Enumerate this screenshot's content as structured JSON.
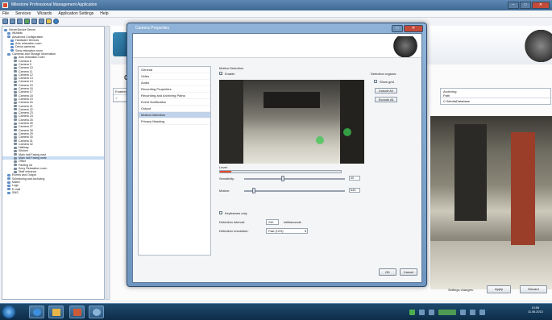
{
  "app": {
    "title": "Milestone Professional Management Application",
    "menu": [
      "File",
      "Services",
      "Wizards",
      "Application Settings",
      "Help"
    ]
  },
  "tree": {
    "items": [
      {
        "label": "ServerDevice Server",
        "type": "root",
        "sel": false
      },
      {
        "label": "Wizards",
        "type": "folder",
        "sel": false
      },
      {
        "label": "Advanced Configuration",
        "type": "folder",
        "sel": false
      },
      {
        "label": "Hardware Devices",
        "type": "folder",
        "sel": false
      },
      {
        "label": "Axis relaxation room",
        "type": "folder",
        "sel": false
      },
      {
        "label": "Demo cameras",
        "type": "folder",
        "sel": false
      },
      {
        "label": "Sony relaxation room",
        "type": "folder",
        "sel": false
      },
      {
        "label": "Cameras and Storage Information",
        "type": "folder",
        "sel": false
      },
      {
        "label": "Axis relaxation room",
        "type": "cam",
        "sel": false
      },
      {
        "label": "Camera 8",
        "type": "cam",
        "sel": false
      },
      {
        "label": "Camera 9",
        "type": "cam",
        "sel": false
      },
      {
        "label": "Camera 10",
        "type": "cam",
        "sel": false
      },
      {
        "label": "Camera 11",
        "type": "cam",
        "sel": false
      },
      {
        "label": "Camera 12",
        "type": "cam",
        "sel": false
      },
      {
        "label": "Camera 13",
        "type": "cam",
        "sel": false
      },
      {
        "label": "Camera 14",
        "type": "cam",
        "sel": false
      },
      {
        "label": "Camera 15",
        "type": "cam",
        "sel": false
      },
      {
        "label": "Camera 16",
        "type": "cam",
        "sel": false
      },
      {
        "label": "Camera 17",
        "type": "cam",
        "sel": false
      },
      {
        "label": "Camera 18",
        "type": "cam",
        "sel": false
      },
      {
        "label": "Camera 19",
        "type": "cam",
        "sel": false
      },
      {
        "label": "Camera 20",
        "type": "cam",
        "sel": false
      },
      {
        "label": "Camera 21",
        "type": "cam",
        "sel": false
      },
      {
        "label": "Camera 22",
        "type": "cam",
        "sel": false
      },
      {
        "label": "Camera 23",
        "type": "cam",
        "sel": false
      },
      {
        "label": "Camera 24",
        "type": "cam",
        "sel": false
      },
      {
        "label": "Camera 25",
        "type": "cam",
        "sel": false
      },
      {
        "label": "Camera 26",
        "type": "cam",
        "sel": false
      },
      {
        "label": "Camera 27",
        "type": "cam",
        "sel": false
      },
      {
        "label": "Camera 28",
        "type": "cam",
        "sel": false
      },
      {
        "label": "Camera 29",
        "type": "cam",
        "sel": false
      },
      {
        "label": "Camera 30",
        "type": "cam",
        "sel": false
      },
      {
        "label": "Camera 31",
        "type": "cam",
        "sel": false
      },
      {
        "label": "Camera 32",
        "type": "cam",
        "sel": false
      },
      {
        "label": "Hallway",
        "type": "cam",
        "sel": false
      },
      {
        "label": "Kitchen",
        "type": "cam",
        "sel": false
      },
      {
        "label": "Main hall Facing east",
        "type": "cam",
        "sel": false
      },
      {
        "label": "Main hall Facing west",
        "type": "cam",
        "sel": true
      },
      {
        "label": "Office",
        "type": "cam",
        "sel": false
      },
      {
        "label": "Parking lot",
        "type": "cam",
        "sel": false
      },
      {
        "label": "Sony Relaxation room",
        "type": "cam",
        "sel": false
      },
      {
        "label": "Staff entrance",
        "type": "cam",
        "sel": false
      },
      {
        "label": "Events and Output",
        "type": "folder",
        "sel": false
      },
      {
        "label": "Scheduling and Archiving",
        "type": "folder",
        "sel": false
      },
      {
        "label": "Matrix",
        "type": "folder",
        "sel": false
      },
      {
        "label": "Logs",
        "type": "folder",
        "sel": false
      },
      {
        "label": "E-mail",
        "type": "folder",
        "sel": false
      },
      {
        "label": "SMS",
        "type": "folder",
        "sel": false
      }
    ]
  },
  "main": {
    "section_title": "Ca",
    "table_header": "Enabled",
    "table_row_check": "✓",
    "right_table": {
      "header1": "Archiving",
      "header2": "Path",
      "row_value": "C:\\MediaDatabase"
    },
    "settings_changes_label": "Settings changes:",
    "apply_label": "Apply",
    "discard_label": "Discard"
  },
  "dialog": {
    "title": "Camera Properties",
    "nav": [
      {
        "label": "General",
        "sel": false
      },
      {
        "label": "Video",
        "sel": false
      },
      {
        "label": "Audio",
        "sel": false
      },
      {
        "label": "Recording Properties",
        "sel": false
      },
      {
        "label": "Recording and Archiving Paths",
        "sel": false
      },
      {
        "label": "Event Notification",
        "sel": false
      },
      {
        "label": "Output",
        "sel": false
      },
      {
        "label": "Motion Detection",
        "sel": true
      },
      {
        "label": "Privacy Masking",
        "sel": false
      }
    ],
    "motion": {
      "heading": "Motion Detection",
      "enable_label": "Enable",
      "enable_checked": true,
      "regions_label": "Detection regions:",
      "show_grid_label": "Show grid",
      "include_all_label": "Include All",
      "exclude_all_label": "Exclude All",
      "level_label": "Level:",
      "level_value": 0.09,
      "sensitivity_label": "Sensitivity:",
      "sensitivity_value": "40",
      "sensitivity_pos": 0.38,
      "motion_label": "Motion:",
      "motion_value": "640",
      "motion_pos": 0.08,
      "keyframes_label": "Keyframes only",
      "keyframes_checked": true,
      "interval_label": "Detection interval:",
      "interval_value": "240",
      "interval_unit": "milliseconds",
      "resolution_label": "Detection resolution:",
      "resolution_value": "Fast (12%)"
    },
    "ok_label": "OK",
    "cancel_label": "Cancel"
  },
  "taskbar": {
    "time": "10:56",
    "date": "11.06.2013"
  }
}
